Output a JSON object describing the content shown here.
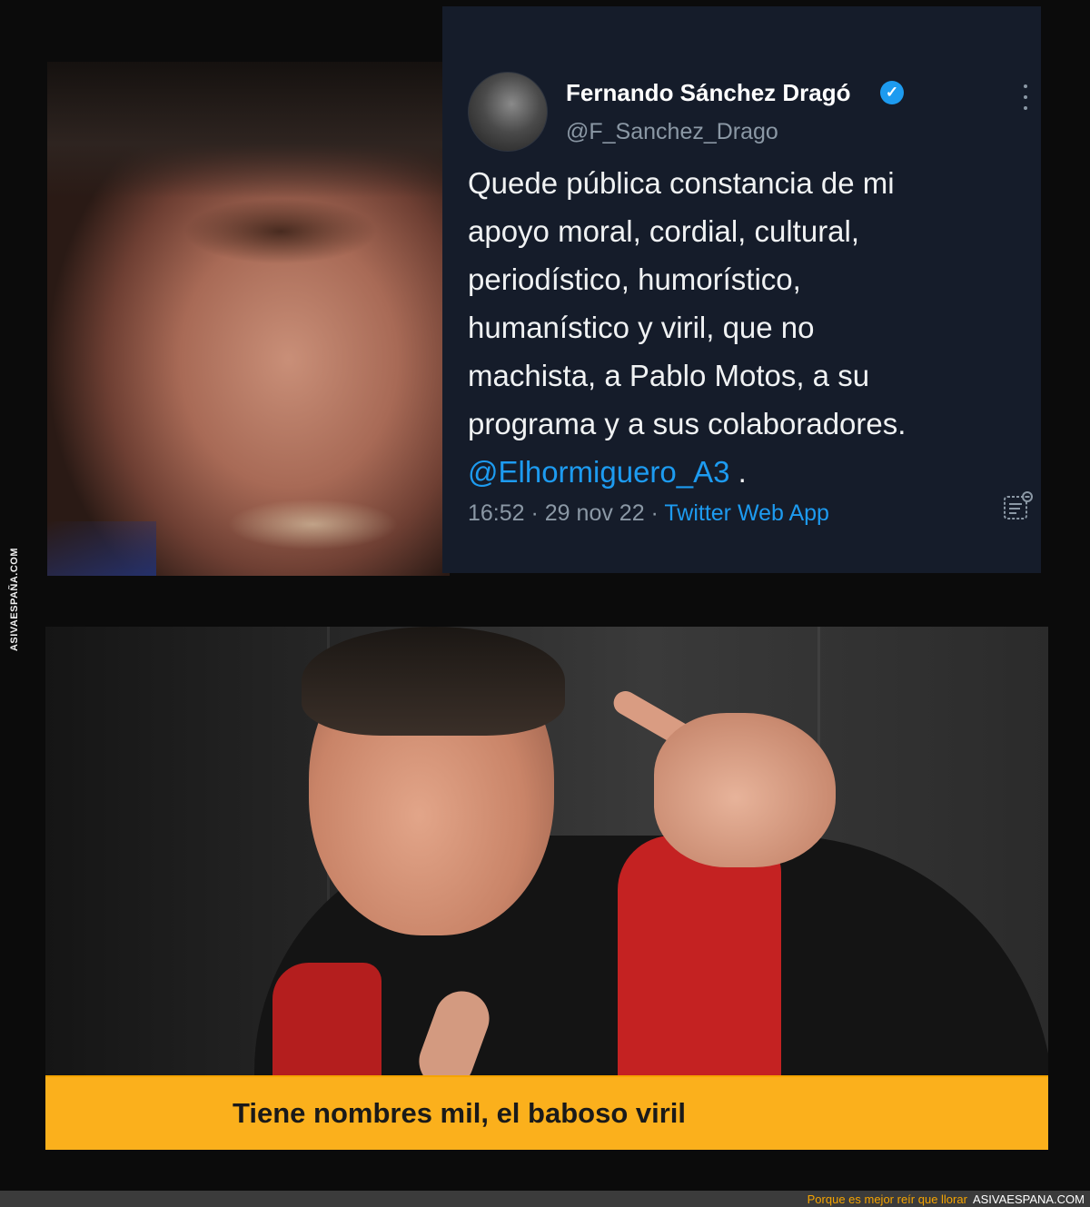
{
  "watermark": {
    "side_text": "ASIVAESPAÑA.COM"
  },
  "tweet": {
    "author_name": "Fernando Sánchez Dragó",
    "verified_icon": "verified-badge-icon",
    "handle": "@F_Sanchez_Drago",
    "text_lines": [
      "Quede pública constancia de mi",
      "apoyo moral, cordial, cultural,",
      "periodístico, humorístico,",
      "humanístico y viril, que no",
      "machista, a Pablo Motos, a su",
      "programa y a sus colaboradores."
    ],
    "mention": "@Elhormiguero_A3",
    "mention_suffix": " .",
    "time": "16:52",
    "separator": " · ",
    "date": "29 nov 22",
    "source": "Twitter Web App",
    "colors": {
      "background": "#151c2a",
      "link": "#1d9bf0",
      "muted": "#8b98a5"
    }
  },
  "caption": {
    "text": "Tiene nombres mil, el baboso viril",
    "color": "#fbb01c"
  },
  "footer": {
    "tagline": "Porque es mejor reír que llorar",
    "brand": "ASIVAESPANA.COM"
  }
}
